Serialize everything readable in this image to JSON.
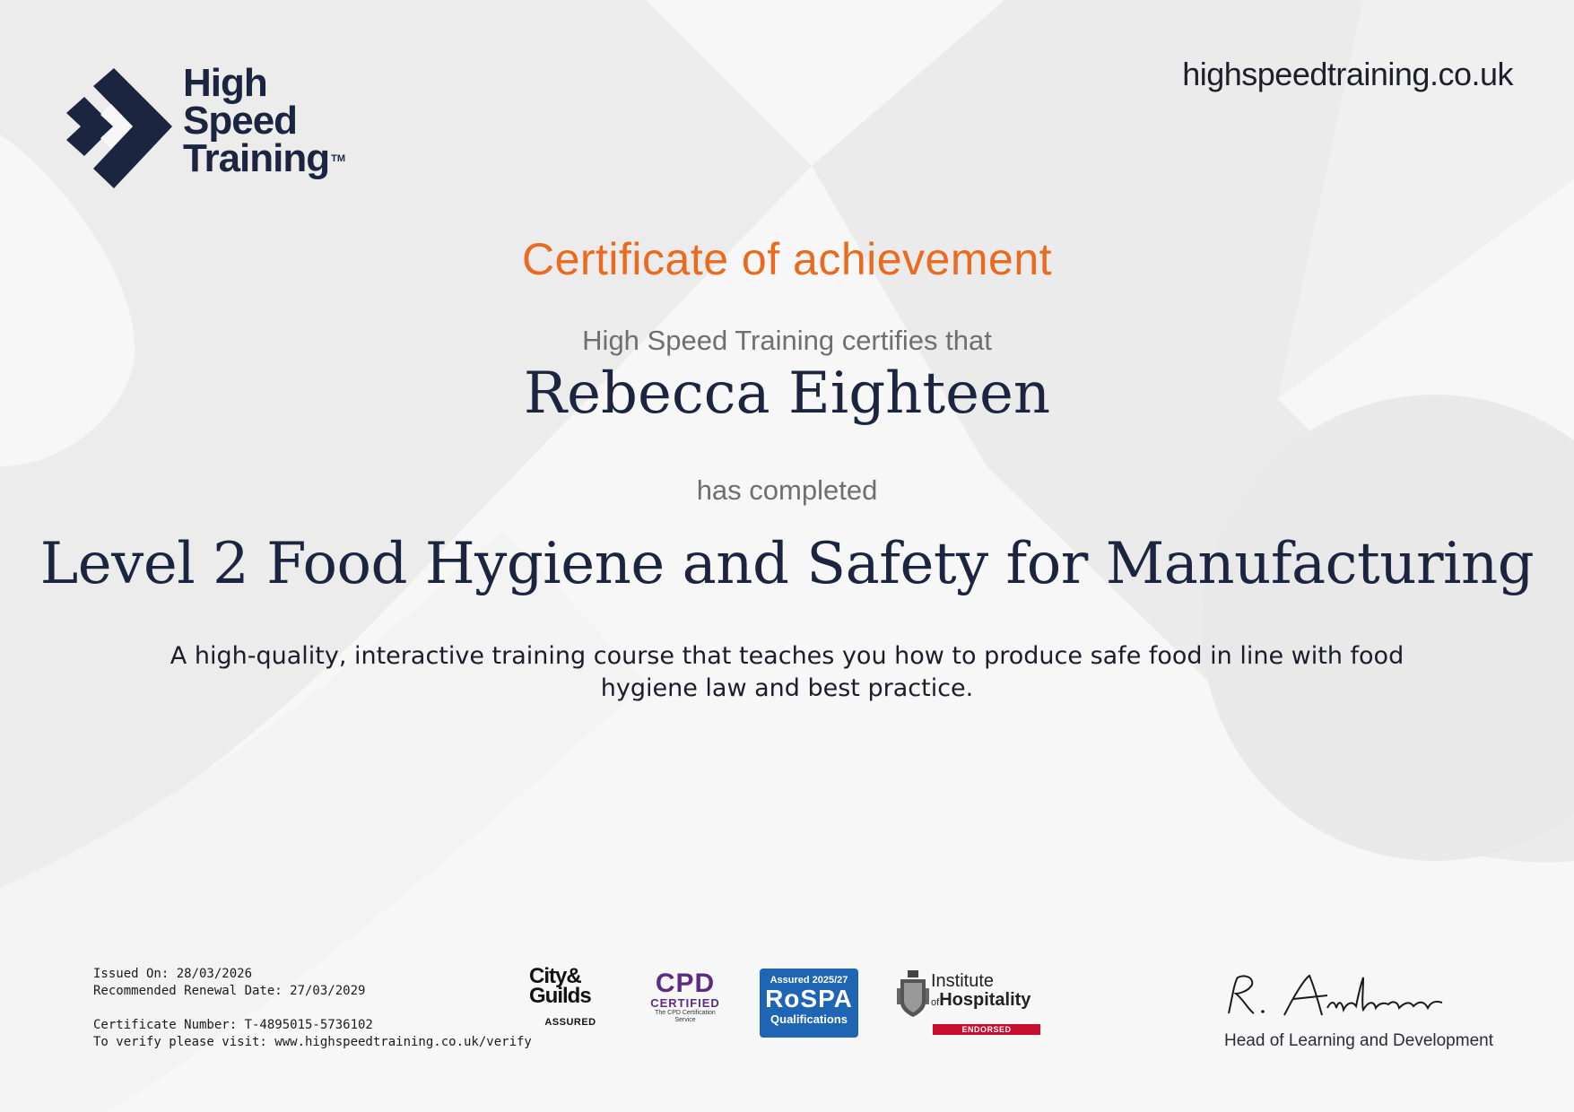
{
  "colors": {
    "navy": "#1c2540",
    "orange": "#ea6a1f",
    "grey": "#6f6f6f",
    "rospa_blue": "#1e66b4",
    "ioh_red": "#c8102e",
    "cpd_purple": "#5a2d82"
  },
  "logo": {
    "line1": "High",
    "line2": "Speed",
    "line3": "Training",
    "tm": "TM",
    "icon": "high-speed-training-chevron-icon"
  },
  "site_url": "highspeedtraining.co.uk",
  "certificate": {
    "title": "Certificate of achievement",
    "certifies": "High Speed Training certifies that",
    "recipient": "Rebecca Eighteen",
    "completed": "has completed",
    "course": "Level 2 Food Hygiene and Safety for Manufacturing",
    "description": "A high-quality, interactive training course that teaches you how to produce safe food in line with food hygiene law and best practice."
  },
  "footer": {
    "issued": "Issued On: 28/03/2026",
    "renewal": "Recommended Renewal Date: 27/03/2029",
    "cert_number": "Certificate Number: T-4895015-5736102",
    "verify": "To verify please visit: www.highspeedtraining.co.uk/verify"
  },
  "badges": {
    "city_guilds": {
      "line1": "City&",
      "line2": "Guilds",
      "sub": "ASSURED"
    },
    "cpd": {
      "big": "CPD",
      "certified": "CERTIFIED",
      "sub1": "The CPD Certification",
      "sub2": "Service"
    },
    "rospa": {
      "top": "Assured 2025/27",
      "mid": "RoSPA",
      "bot": "Qualifications"
    },
    "ioh": {
      "institute": "Institute",
      "of": "of",
      "hospitality": "Hospitality",
      "endorsed": "ENDORSED"
    }
  },
  "signature": {
    "role": "Head of Learning and Development"
  }
}
